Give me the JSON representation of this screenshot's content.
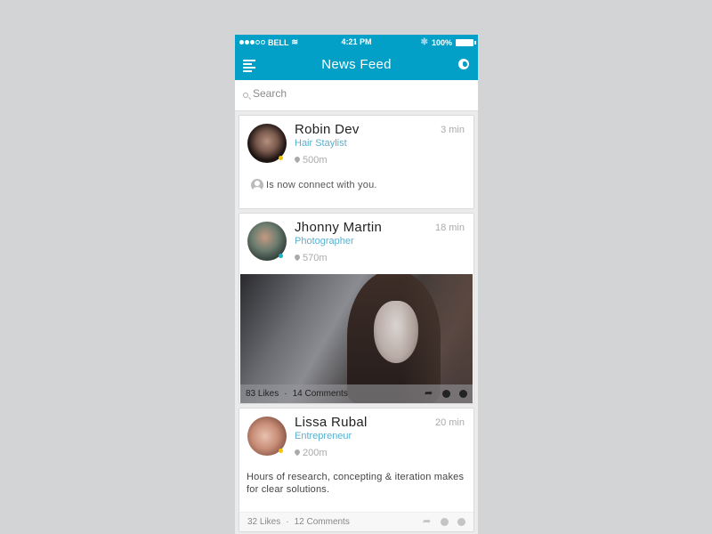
{
  "status_bar": {
    "carrier": "BELL",
    "signal_bars_filled": 3,
    "signal_bars_total": 5,
    "time": "4:21 PM",
    "battery": "100%"
  },
  "nav": {
    "title": "News Feed",
    "left_icon": "menu-icon",
    "right_icon": "globe-icon"
  },
  "search": {
    "placeholder": "Search",
    "value": ""
  },
  "colors": {
    "accent": "#029fc6",
    "role_text": "#5ab0ce",
    "status_yellow": "#f5c400",
    "status_teal": "#1bb3c1"
  },
  "feed": [
    {
      "name": "Robin Dev",
      "role": "Hair Staylist",
      "time": "3 min",
      "distance": "500m",
      "status": "yellow",
      "activity": "Is now connect with you."
    },
    {
      "name": "Jhonny Martin",
      "role": "Photographer",
      "time": "18 min",
      "distance": "570m",
      "status": "teal",
      "likes": "83 Likes",
      "separator": "·",
      "comments": "14 Comments"
    },
    {
      "name": "Lissa Rubal",
      "role": "Entrepreneur",
      "time": "20 min",
      "distance": "200m",
      "status": "yellow",
      "text": "Hours of research, concepting & iteration makes for clear solutions.",
      "likes": "32 Likes",
      "separator": "·",
      "comments": "12 Comments"
    }
  ]
}
